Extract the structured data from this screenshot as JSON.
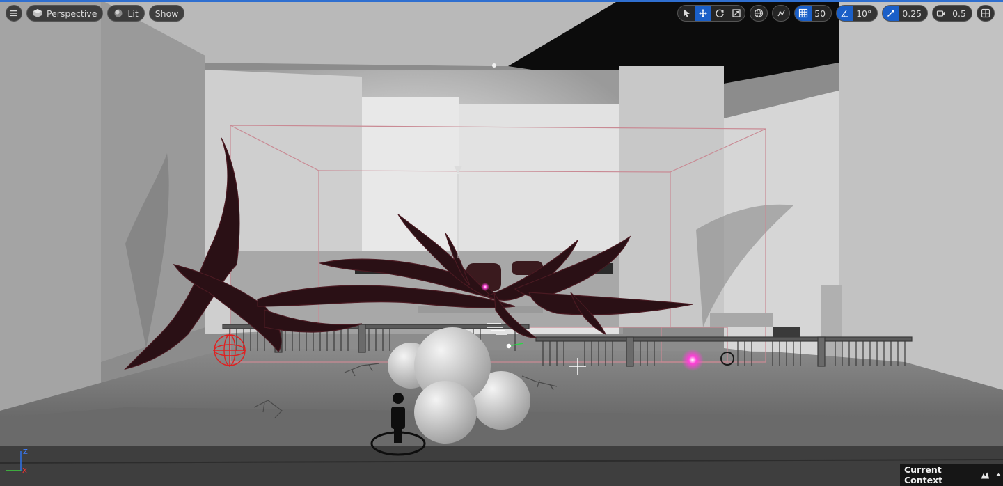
{
  "toolbar_left": {
    "menu_icon": "hamburger-icon",
    "perspective_label": "Perspective",
    "lit_label": "Lit",
    "show_label": "Show"
  },
  "toolbar_right": {
    "grid_snap_value": "50",
    "rotation_snap_value": "10°",
    "scale_snap_value": "0.25",
    "camera_speed_value": "0.5"
  },
  "axis": {
    "z": "Z",
    "x": "X"
  },
  "context": {
    "label": "Current Context"
  },
  "colors": {
    "accent": "#1a5fc8",
    "volume_outline": "#c98a94",
    "glow": "#ff3fd8"
  }
}
